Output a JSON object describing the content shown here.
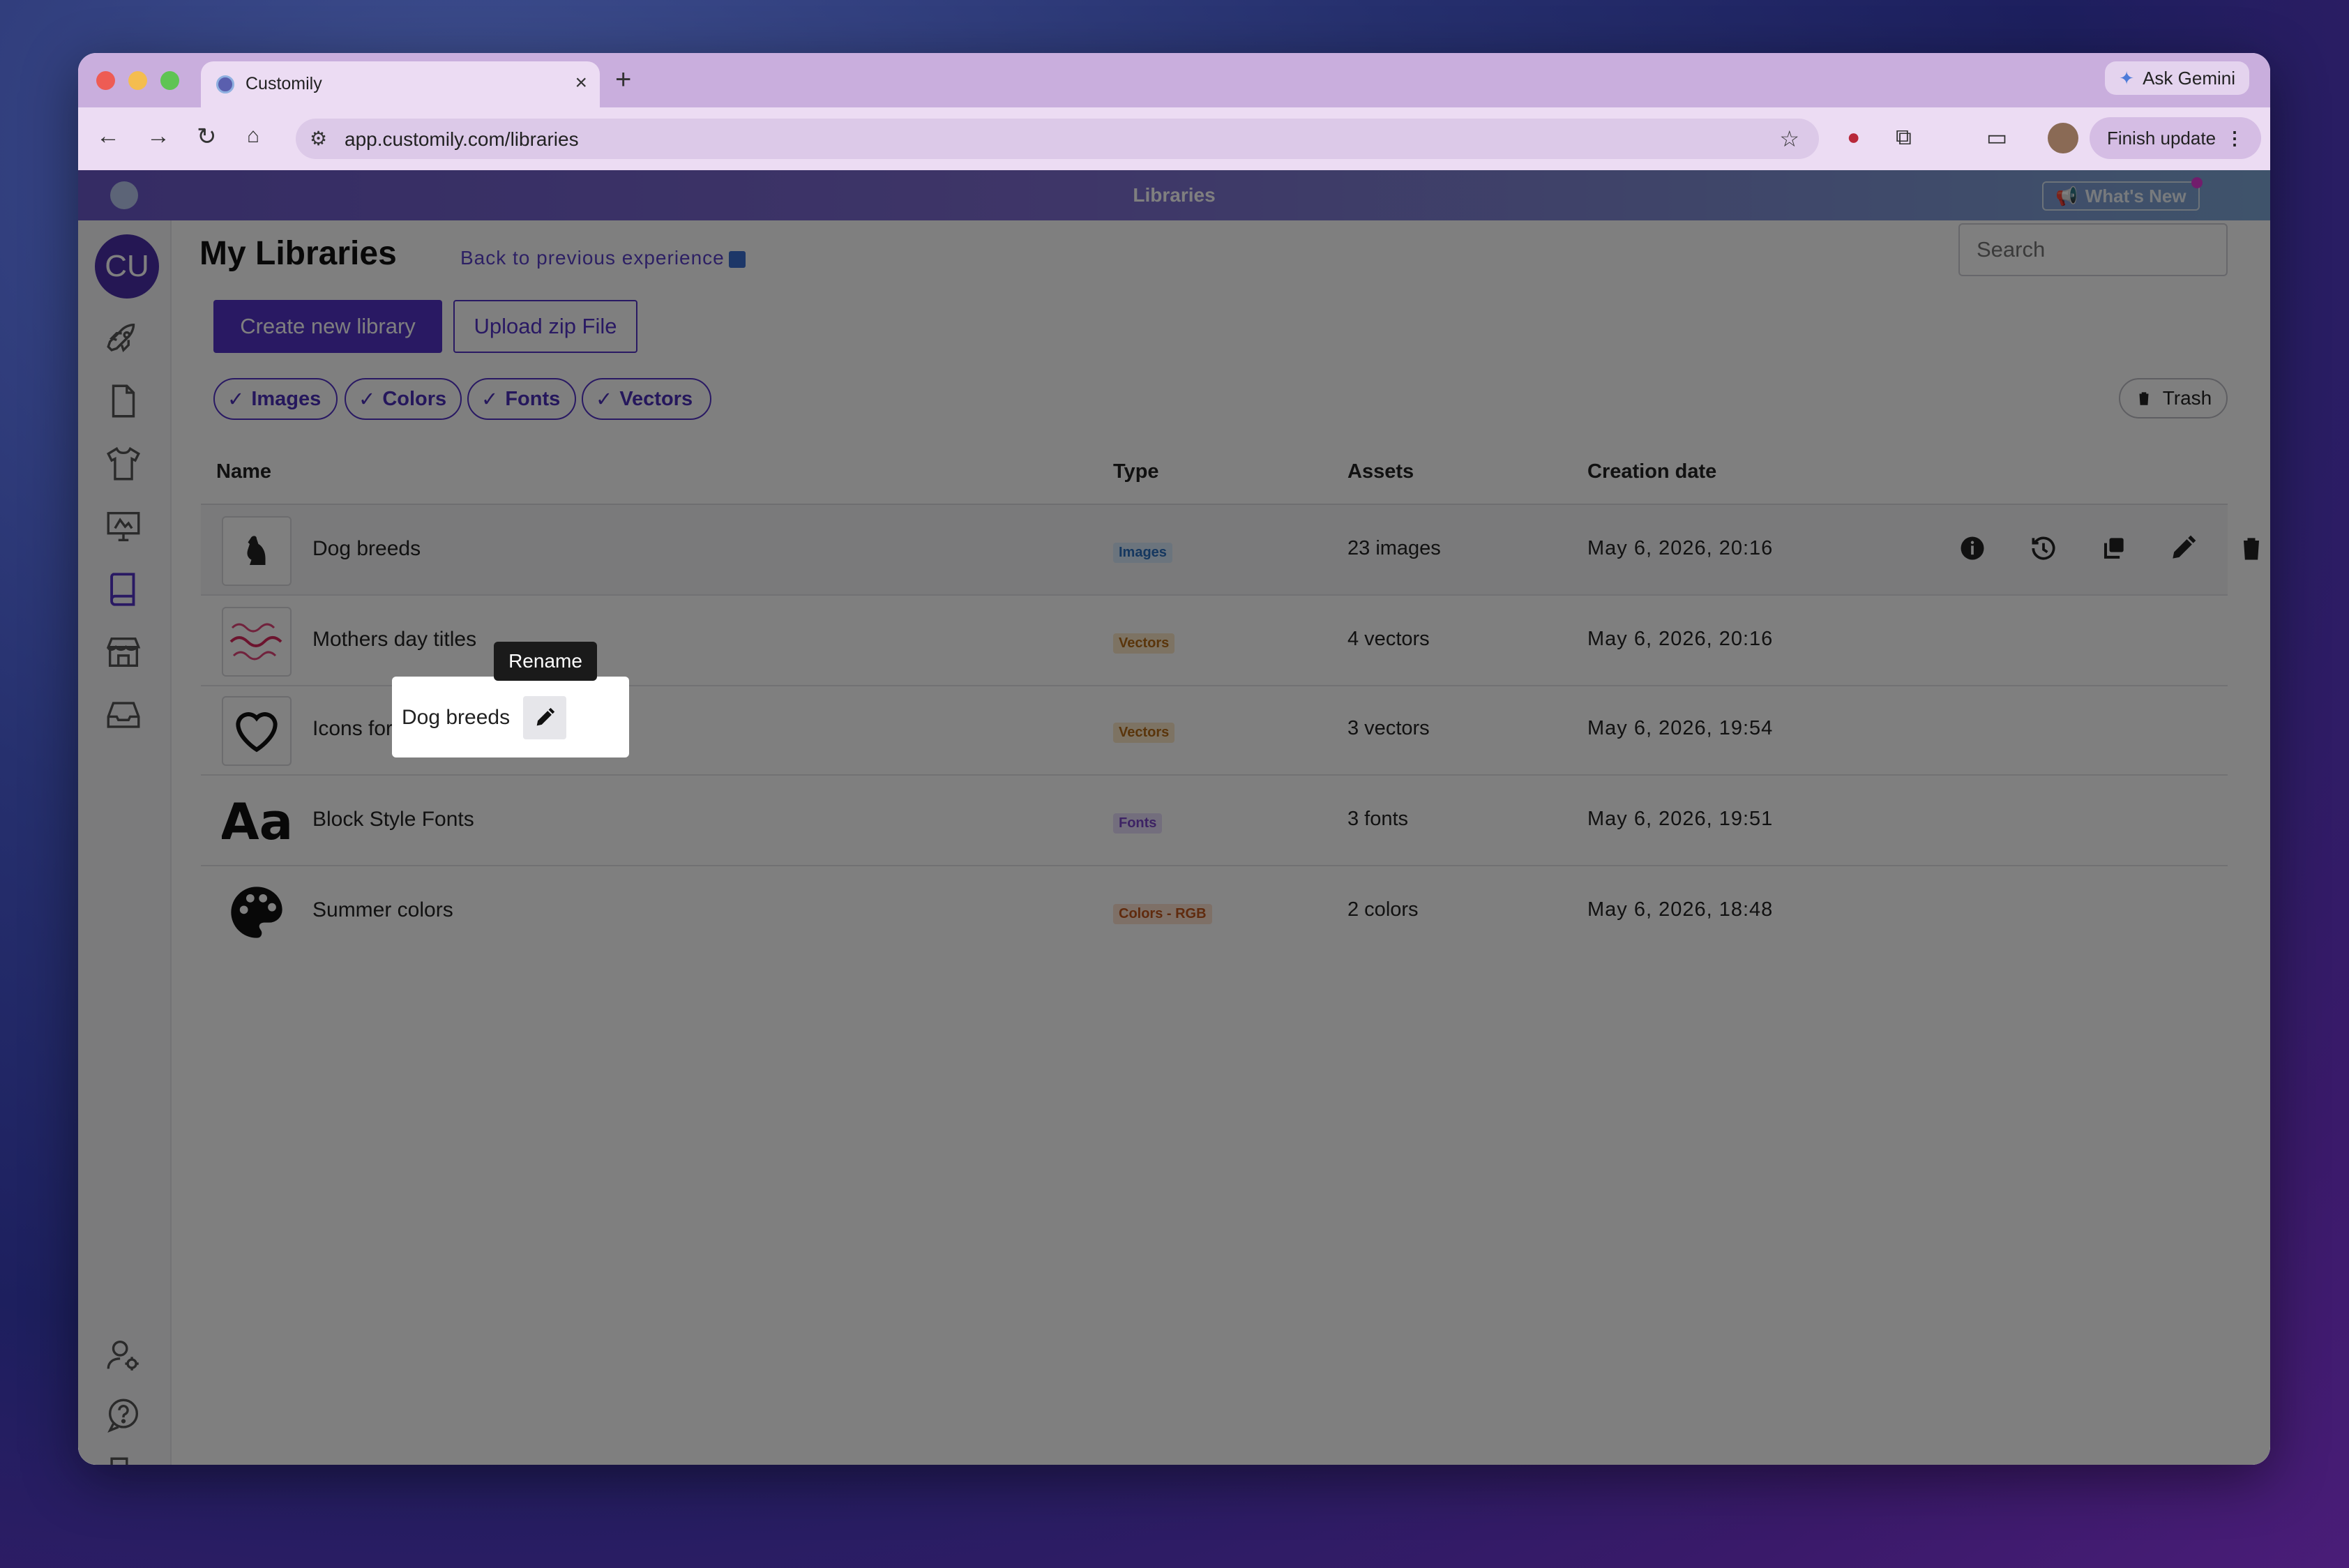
{
  "browser": {
    "tab_title": "Customily",
    "tab_close": "×",
    "new_tab": "+",
    "ask_gemini": "Ask Gemini",
    "url": "app.customily.com/libraries",
    "finish_update": "Finish update"
  },
  "appbar": {
    "title": "Libraries",
    "whats_new": "What's New"
  },
  "sidebar": {
    "avatar_initials": "CU",
    "icons": [
      "rocket-icon",
      "document-icon",
      "tshirt-icon",
      "monitor-icon",
      "book-icon",
      "store-icon",
      "inbox-icon",
      "user-settings-icon",
      "help-icon",
      "logout-icon"
    ]
  },
  "page": {
    "title": "My Libraries",
    "back_link": "Back to previous experience",
    "search_placeholder": "Search",
    "create_button": "Create new library",
    "upload_button": "Upload zip File",
    "trash_button": "Trash"
  },
  "filters": [
    {
      "label": "Images",
      "check": "✓"
    },
    {
      "label": "Colors",
      "check": "✓"
    },
    {
      "label": "Fonts",
      "check": "✓"
    },
    {
      "label": "Vectors",
      "check": "✓"
    }
  ],
  "table": {
    "headers": {
      "name": "Name",
      "type": "Type",
      "assets": "Assets",
      "date": "Creation date"
    },
    "rows": [
      {
        "name": "Dog breeds",
        "type": "Images",
        "assets": "23 images",
        "date": "May 6, 2026, 20:16"
      },
      {
        "name": "Mothers day titles",
        "type": "Vectors",
        "assets": "4 vectors",
        "date": "May 6, 2026, 20:16"
      },
      {
        "name": "Icons for Maps",
        "type": "Vectors",
        "assets": "3 vectors",
        "date": "May 6, 2026, 19:54"
      },
      {
        "name": "Block Style Fonts",
        "type": "Fonts",
        "assets": "3 fonts",
        "date": "May 6, 2026, 19:51"
      },
      {
        "name": "Summer colors",
        "type": "Colors - RGB",
        "assets": "2 colors",
        "date": "May 6, 2026, 18:48"
      }
    ],
    "row_actions": [
      "info-icon",
      "history-icon",
      "duplicate-icon",
      "edit-icon",
      "delete-icon"
    ]
  },
  "thumbs": {
    "font_sample": "Aa"
  },
  "tooltip": {
    "rename": "Rename"
  }
}
